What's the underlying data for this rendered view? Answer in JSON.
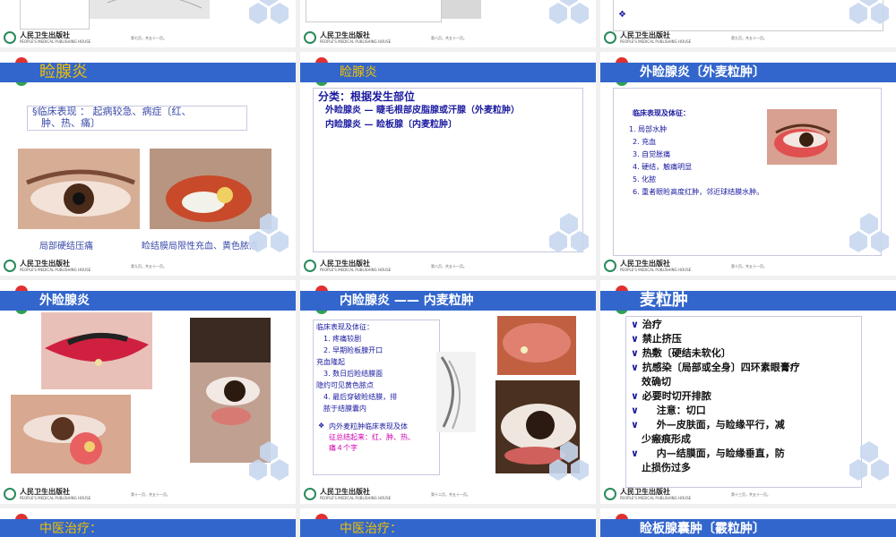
{
  "common": {
    "logo_cn": "人民卫生出版社",
    "logo_en": "PEOPLE'S MEDICAL PUBLISHING HOUSE"
  },
  "slides": [
    {
      "page": "第七页，共五十一页。",
      "items": []
    },
    {
      "page": "第八页，共五十一页。",
      "items": []
    },
    {
      "page": "第九页，共五十一页。",
      "items": [
        "❖"
      ]
    },
    {
      "title": "睑腺炎",
      "page": "第九页，共五十一页。",
      "items": [
        "§临床表现 ： 起病较急、病症〔红、",
        "肿、热、痛〕"
      ],
      "captions": [
        "局部硬结压痛",
        "睑结膜局限性充血、黄色脓点"
      ]
    },
    {
      "title": "睑腺炎",
      "page": "第八页，共五十一页。",
      "items": [
        "分类：根据发生部位",
        "外睑腺炎 — 睫毛根部皮脂腺或汗腺（外麦粒肿）",
        "内睑腺炎 — 睑板腺〔内麦粒肿〕"
      ]
    },
    {
      "title": "外睑腺炎〔外麦粒肿〕",
      "page": "第十页，共五十一页。",
      "items": [
        "临床表现及体征：",
        "1.   局部水肿",
        "2.   充血",
        "3.   自觉胀痛",
        "4.   硬结，触痛明显",
        "5.   化脓",
        "6.   重者眼睑高度红肿，邻近球结膜水肿。"
      ]
    },
    {
      "title": "外睑腺炎",
      "page": "第十一页，共五十一页。",
      "items": []
    },
    {
      "title": "内睑腺炎 —— 内麦粒肿",
      "page": "第十二页，共五十一页。",
      "items": [
        "临床表现及体征：",
        "1.   疼痛较剧",
        "2.   早期睑板腺开口",
        "充血隆起",
        "3.   数日后睑结膜面",
        "隐约可见黄色脓点",
        "4.   最后穿破睑结膜，排",
        "脓于结膜囊内",
        "内外麦粒肿临床表现及体",
        "征总结起来：红、肿、热、",
        "痛４个字"
      ],
      "bullet": "❖"
    },
    {
      "title": "麦粒肿",
      "page": "第十三页，共五十一页。",
      "marker": "∨",
      "items": [
        "治疗",
        "禁止挤压",
        "热敷〔硬结未软化〕",
        "抗感染〔局部或全身〕四环素眼膏疗",
        "效确切",
        "必要时切开排脓",
        "注意：切口",
        "外—皮肤面，与睑缘平行，减",
        "少瘢痕形成",
        "内—结膜面，与睑缘垂直，防",
        "止损伤过多"
      ]
    },
    {
      "title": "中医治疗：",
      "page": "",
      "items": []
    },
    {
      "title": "中医治疗：",
      "page": "",
      "items": []
    },
    {
      "title": "睑板腺囊肿〔霰粒肿〕",
      "page": "",
      "items": []
    }
  ]
}
